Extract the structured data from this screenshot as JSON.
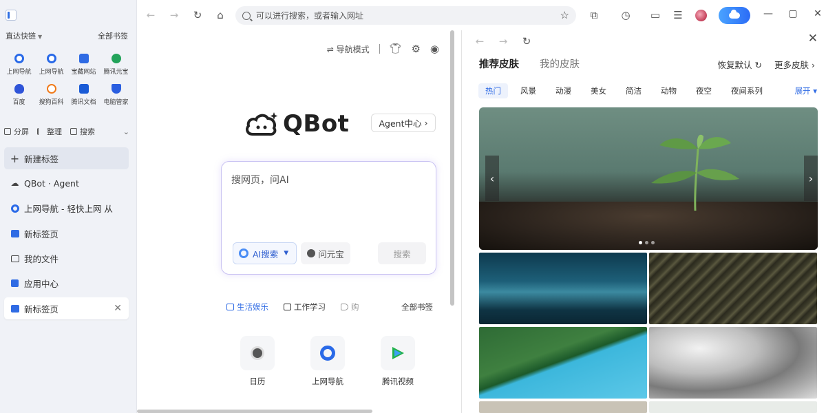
{
  "colors": {
    "accent": "#2f6be4",
    "sidebar_bg": "#f0f2f7",
    "cloud_button": "#3a86f8"
  },
  "sidebar": {
    "quick_links_label": "直达快链",
    "all_bookmarks_label": "全部书签",
    "quick_links": [
      {
        "label": "上网导航",
        "icon": "qq-browser-nav-icon",
        "color": "#2a6ae8"
      },
      {
        "label": "上网导航",
        "icon": "qq-browser-nav-icon",
        "color": "#2a6ae8"
      },
      {
        "label": "宝藏网站",
        "icon": "treasure-sites-icon",
        "color": "#2f6be4"
      },
      {
        "label": "腾讯元宝",
        "icon": "yuanbao-icon",
        "color": "#22a35a"
      },
      {
        "label": "百度",
        "icon": "baidu-paw-icon",
        "color": "#2f54d8"
      },
      {
        "label": "搜狗百科",
        "icon": "sogou-baike-icon",
        "color": "#f07a1a"
      },
      {
        "label": "腾讯文档",
        "icon": "tencent-docs-icon",
        "color": "#1a5bd6"
      },
      {
        "label": "电脑管家",
        "icon": "pc-manager-shield-icon",
        "color": "#2a5ee0"
      }
    ],
    "tools": {
      "split": "分屏",
      "organize": "整理",
      "search": "搜索"
    },
    "items": [
      {
        "label": "新建标签",
        "icon": "plus-icon"
      },
      {
        "label": "QBot · Agent",
        "icon": "qbot-cloud-icon"
      },
      {
        "label": "上网导航 - 轻快上网 从",
        "icon": "qq-browser-nav-icon"
      },
      {
        "label": "新标签页",
        "icon": "home-tab-icon"
      },
      {
        "label": "我的文件",
        "icon": "folder-icon"
      },
      {
        "label": "应用中心",
        "icon": "puzzle-icon"
      },
      {
        "label": "新标签页",
        "icon": "home-tab-icon"
      }
    ]
  },
  "toolbar": {
    "address_placeholder": "可以进行搜索，或者输入网址"
  },
  "main": {
    "nav_mode_label": "导航模式",
    "logo_text": "QBot",
    "agent_center_label": "Agent中心",
    "search_placeholder": "搜网页，问AI",
    "ai_search_label": "AI搜索",
    "ask_yuanbao_label": "问元宝",
    "search_button_label": "搜索",
    "categories": [
      "生活娱乐",
      "工作学习",
      "购"
    ],
    "all_bookmarks_label": "全部书签",
    "apps": [
      {
        "label": "日历",
        "icon": "calendar-icon"
      },
      {
        "label": "上网导航",
        "icon": "qq-browser-nav-icon"
      },
      {
        "label": "腾讯视频",
        "icon": "tencent-video-icon"
      }
    ]
  },
  "panel": {
    "tabs": [
      "推荐皮肤",
      "我的皮肤"
    ],
    "restore_label": "恢复默认",
    "more_skins_label": "更多皮肤",
    "categories": [
      "热门",
      "风景",
      "动漫",
      "美女",
      "简洁",
      "动物",
      "夜空",
      "夜间系列"
    ],
    "expand_label": "展开",
    "banner_slides": 3,
    "banner_active_slide": 1
  }
}
